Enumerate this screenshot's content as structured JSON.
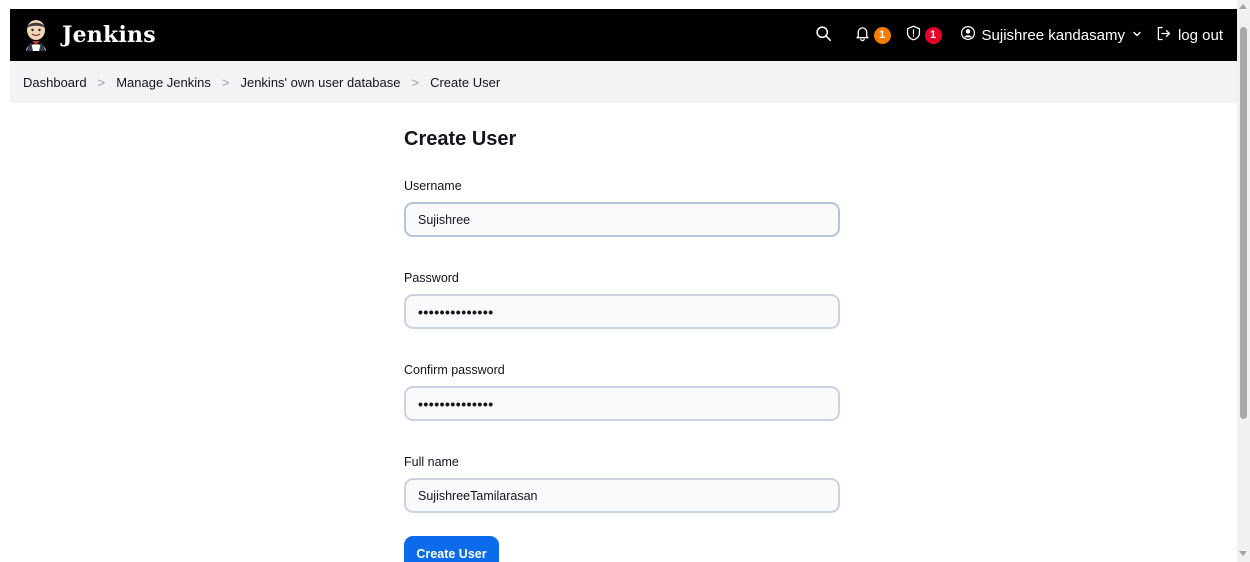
{
  "header": {
    "brand": "Jenkins",
    "notifications_count": "1",
    "security_count": "1",
    "user_name": "Sujishree kandasamy",
    "logout_label": "log out"
  },
  "breadcrumbs": [
    {
      "label": "Dashboard"
    },
    {
      "label": "Manage Jenkins"
    },
    {
      "label": "Jenkins' own user database"
    },
    {
      "label": "Create User"
    }
  ],
  "form": {
    "title": "Create User",
    "username_label": "Username",
    "username_value": "Sujishree",
    "password_label": "Password",
    "password_masked": "••••••••••••••",
    "confirm_label": "Confirm password",
    "confirm_masked": "••••••••••••••",
    "fullname_label": "Full name",
    "fullname_value": "SujishreeTamilarasan",
    "submit_label": "Create User"
  },
  "colors": {
    "header_bg": "#000000",
    "breadcrumb_bg": "#f2f3f5",
    "primary_button": "#0b6bea",
    "badge_orange": "#f57c00",
    "badge_red": "#e60026"
  }
}
